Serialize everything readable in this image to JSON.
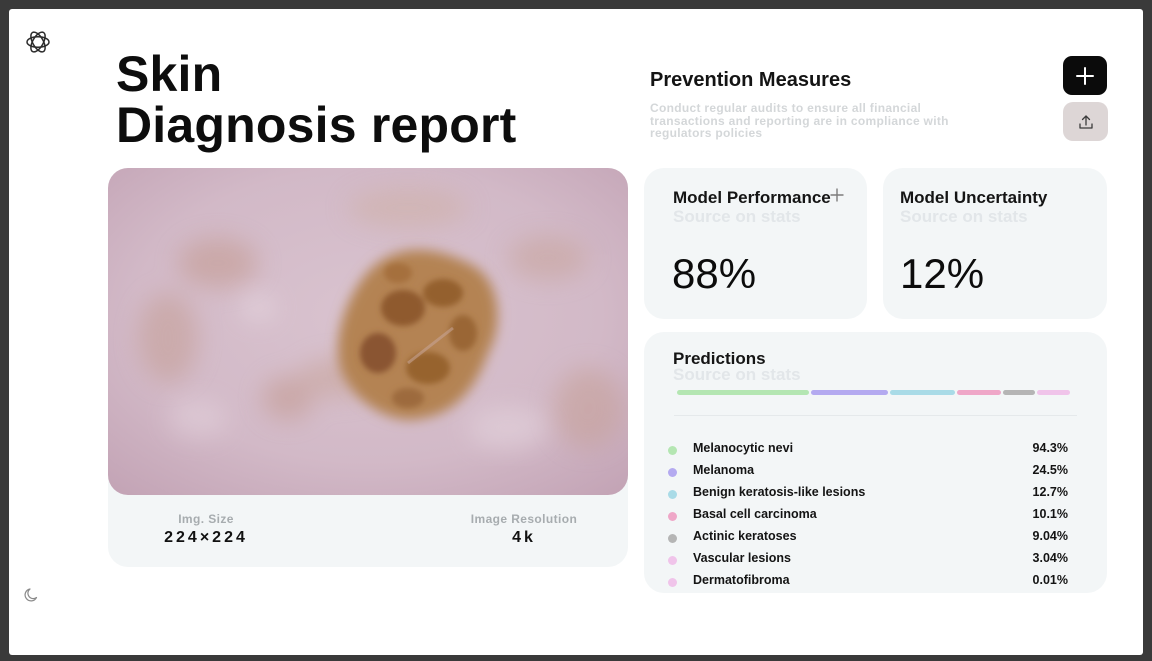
{
  "header": {
    "title_line1": "Skin",
    "title_line2": "Diagnosis report"
  },
  "image_card": {
    "img_size_label": "Img. Size",
    "img_size_value": "224×224",
    "resolution_label": "Image Resolution",
    "resolution_value": "4k"
  },
  "prevention": {
    "title": "Prevention Measures",
    "description": "Conduct regular audits to ensure all financial transactions and reporting are in compliance with regulators policies"
  },
  "model_performance": {
    "title": "Model Performance",
    "subtitle": "Source on stats",
    "value": "88%"
  },
  "model_uncertainty": {
    "title": "Model Uncertainty",
    "subtitle": "Source on stats",
    "value": "12%"
  },
  "predictions": {
    "title": "Predictions",
    "subtitle": "Source on stats",
    "items": [
      {
        "name": "Melanocytic nevi",
        "value": "94.3%",
        "color": "#b4e6b2"
      },
      {
        "name": "Melanoma",
        "value": "24.5%",
        "color": "#b4aaf0"
      },
      {
        "name": "Benign keratosis-like lesions",
        "value": "12.7%",
        "color": "#a9dbe7"
      },
      {
        "name": "Basal cell carcinoma",
        "value": "10.1%",
        "color": "#efa7c8"
      },
      {
        "name": "Actinic keratoses",
        "value": "9.04%",
        "color": "#b5b5b5"
      },
      {
        "name": "Vascular lesions",
        "value": "3.04%",
        "color": "#f0c4ea"
      },
      {
        "name": "Dermatofibroma",
        "value": "0.01%",
        "color": "#f0c4ea"
      }
    ]
  },
  "icons": {
    "logo": "openai-logo-icon",
    "add": "plus-icon",
    "upload": "upload-icon",
    "theme": "moon-icon"
  }
}
